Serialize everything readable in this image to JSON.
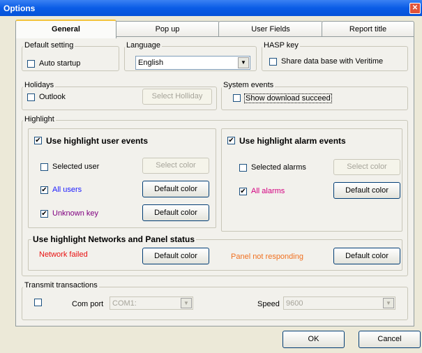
{
  "window": {
    "title": "Options",
    "close_glyph": "✕"
  },
  "tabs": [
    "General",
    "Pop up",
    "User Fields",
    "Report title"
  ],
  "default_setting": {
    "label": "Default setting",
    "auto_startup": "Auto startup"
  },
  "language": {
    "label": "Language",
    "value": "English"
  },
  "hasp": {
    "label": "HASP key",
    "share": "Share data base with Veritime"
  },
  "holidays": {
    "label": "Holidays",
    "outlook": "Outlook",
    "select_button": "Select Holliday"
  },
  "system_events": {
    "label": "System events",
    "show_download": "Show download succeed"
  },
  "highlight": {
    "label": "Highlight",
    "user": {
      "title": "Use highlight user events",
      "selected_user": "Selected user",
      "select_color": "Select color",
      "all_users": "All users",
      "default_color_1": "Default color",
      "unknown_key": "Unknown key",
      "default_color_2": "Default color"
    },
    "alarm": {
      "title": "Use highlight alarm events",
      "selected_alarms": "Selected alarms",
      "select_color": "Select color",
      "all_alarms": "All alarms",
      "default_color": "Default color"
    },
    "network": {
      "title": "Use highlight Networks and Panel status",
      "network_failed": "Network failed",
      "default_color_1": "Default color",
      "panel_not_responding": "Panel not responding",
      "default_color_2": "Default color"
    }
  },
  "transmit": {
    "label": "Transmit transactions",
    "com_port_label": "Com port",
    "com_port_value": "COM1:",
    "speed_label": "Speed",
    "speed_value": "9600"
  },
  "footer": {
    "ok": "OK",
    "cancel": "Cancel"
  },
  "colors": {
    "all_users": "#1a1aff",
    "unknown_key": "#800080",
    "all_alarms": "#d40080",
    "network_failed": "#e81010",
    "panel_not_responding": "#f07020"
  },
  "checks": {
    "mark": "✔"
  }
}
